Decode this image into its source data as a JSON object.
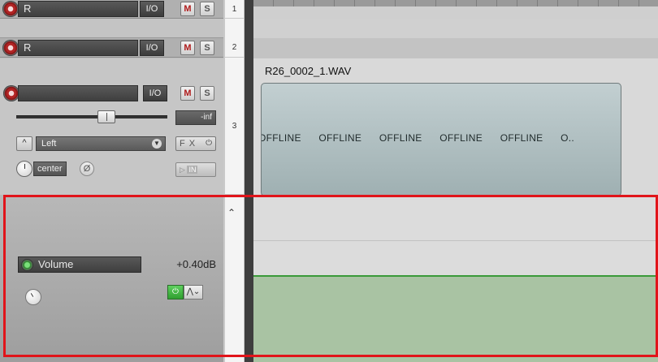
{
  "tracks": [
    {
      "number": "1",
      "name": "R",
      "io": "I/O",
      "mute": "M",
      "solo": "S"
    },
    {
      "number": "2",
      "name": "R",
      "io": "I/O",
      "mute": "M",
      "solo": "S"
    },
    {
      "number": "3",
      "name": "",
      "io": "I/O",
      "mute": "M",
      "solo": "S",
      "volume_readout": "-inf",
      "input_channel": "Left",
      "fx_label": "F X",
      "fx_power": "⏻",
      "pan_label": "center",
      "phase_symbol": "Ø",
      "input_monitor": "IN"
    }
  ],
  "envelope": {
    "name": "Volume",
    "value": "+0.40dB",
    "power": "⏻",
    "mode": "⋀⌄"
  },
  "media_item": {
    "title": "R26_0002_1.WAV",
    "offline_texts": [
      "OFFLINE",
      "OFFLINE",
      "OFFLINE",
      "OFFLINE",
      "OFFLINE",
      "O.."
    ]
  },
  "colors": {
    "highlight": "#e1141a",
    "envelope_line": "#3a9a3a",
    "item_fill": "#b3c2c4"
  }
}
